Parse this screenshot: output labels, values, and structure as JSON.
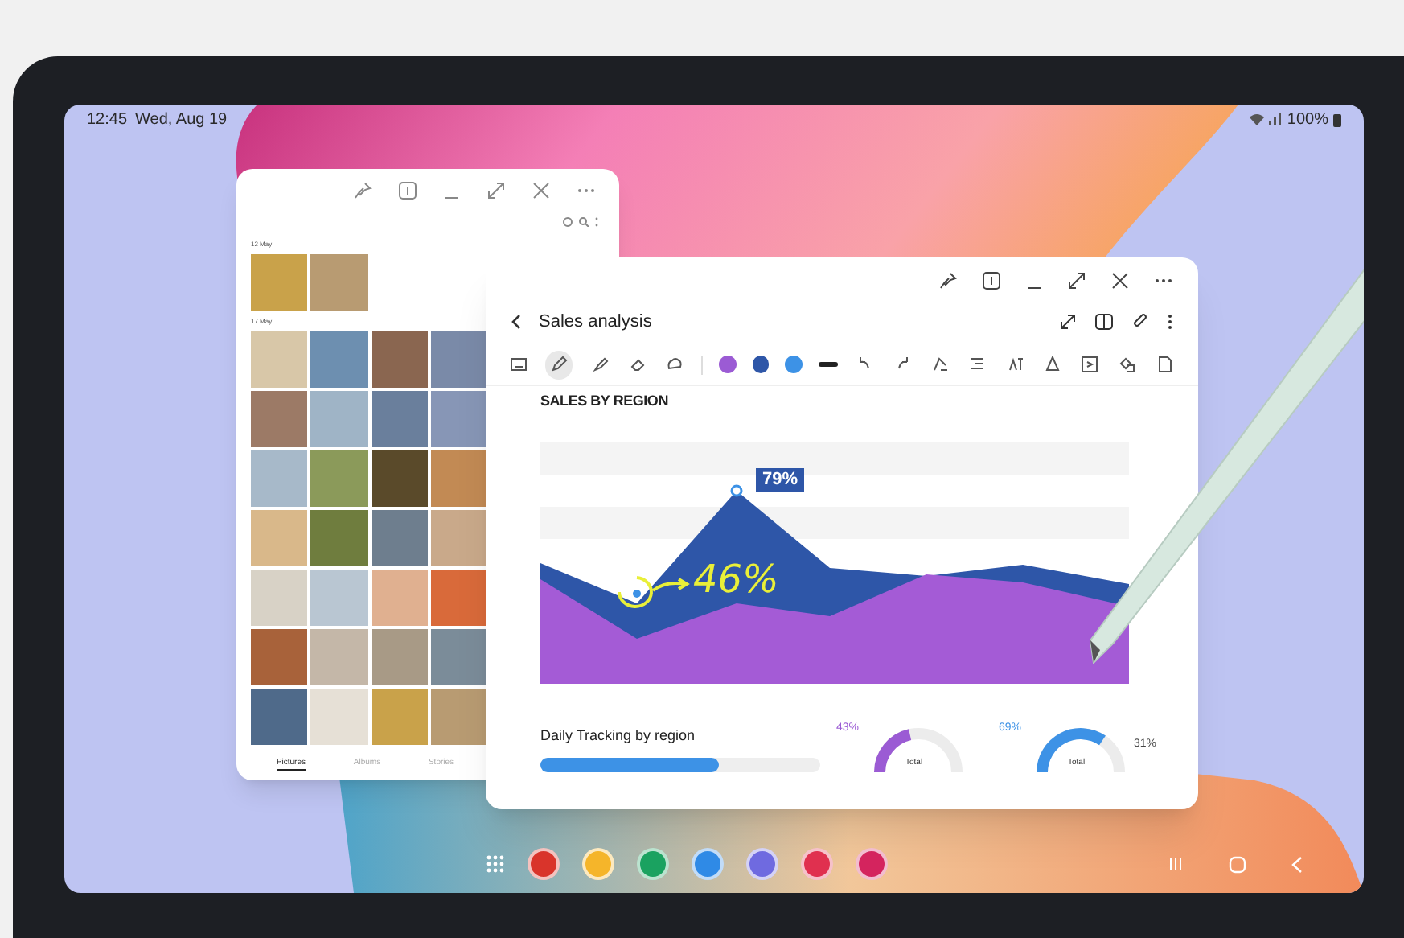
{
  "status_bar": {
    "time": "12:45",
    "date": "Wed, Aug 19",
    "battery": "100%"
  },
  "gallery": {
    "sections": [
      {
        "label": "12 May"
      },
      {
        "label": "17 May"
      }
    ],
    "tabs": [
      {
        "label": "Pictures",
        "selected": true
      },
      {
        "label": "Albums",
        "selected": false
      },
      {
        "label": "Stories",
        "selected": false
      }
    ]
  },
  "notes": {
    "title": "Sales analysis",
    "pen_colors": [
      {
        "color": "#9b5bd4",
        "selected": false
      },
      {
        "color": "#2e56a8",
        "selected": false
      },
      {
        "color": "#3d92e6",
        "selected": false
      }
    ],
    "heading": "SALES BY REGION",
    "chart": {
      "peak_label": "79%",
      "note": "46%"
    },
    "tracking": {
      "title": "Daily Tracking by region",
      "level": 0.64
    },
    "gauges": [
      {
        "value": "43%",
        "label": "Total",
        "level": 0.43,
        "color": "#9b5bd4"
      },
      {
        "value": "69%",
        "label": "Total",
        "level": 0.69,
        "color": "#3d92e6",
        "rest": "31%"
      }
    ]
  },
  "dock": {
    "apps": [
      {
        "color": "#d9342b"
      },
      {
        "color": "#f5b52a"
      },
      {
        "color": "#1aa260"
      },
      {
        "color": "#2f8ae6"
      },
      {
        "color": "#6f6ae0"
      },
      {
        "color": "#e0304f"
      },
      {
        "color": "#d4245e"
      }
    ]
  }
}
